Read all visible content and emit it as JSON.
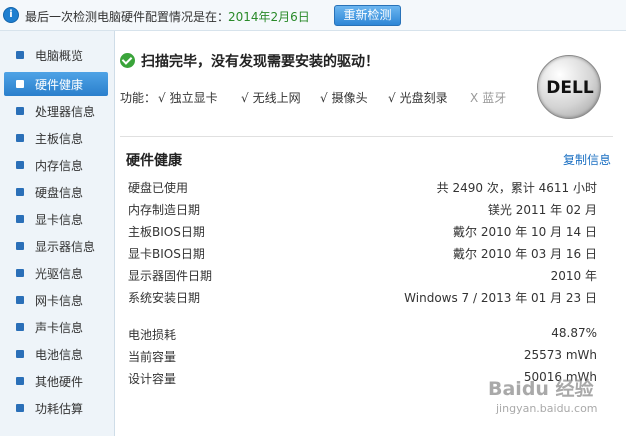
{
  "topbar": {
    "last_check_text": "最后一次检测电脑硬件配置情况是在：",
    "last_check_date": "2014年2月6日",
    "recheck_label": "重新检测"
  },
  "sidebar": {
    "items": [
      {
        "label": "电脑概览",
        "active": false
      },
      {
        "label": "硬件健康",
        "active": true
      },
      {
        "label": "处理器信息",
        "active": false
      },
      {
        "label": "主板信息",
        "active": false
      },
      {
        "label": "内存信息",
        "active": false
      },
      {
        "label": "硬盘信息",
        "active": false
      },
      {
        "label": "显卡信息",
        "active": false
      },
      {
        "label": "显示器信息",
        "active": false
      },
      {
        "label": "光驱信息",
        "active": false
      },
      {
        "label": "网卡信息",
        "active": false
      },
      {
        "label": "声卡信息",
        "active": false
      },
      {
        "label": "电池信息",
        "active": false
      },
      {
        "label": "其他硬件",
        "active": false
      },
      {
        "label": "功耗估算",
        "active": false
      }
    ]
  },
  "scan": {
    "title": "扫描完毕，没有发现需要安装的驱动！"
  },
  "features": {
    "label": "功能：",
    "items": [
      {
        "mark": "√",
        "name": "独立显卡",
        "available": true
      },
      {
        "mark": "√",
        "name": "无线上网",
        "available": true
      },
      {
        "mark": "√",
        "name": "摄像头",
        "available": true
      },
      {
        "mark": "√",
        "name": "光盘刻录",
        "available": true
      },
      {
        "mark": "X",
        "name": "蓝牙",
        "available": false
      }
    ]
  },
  "brand": {
    "logo_text": "DELL"
  },
  "health": {
    "title": "硬件健康",
    "copy_label": "复制信息",
    "rows": [
      {
        "label": "硬盘已使用",
        "value": "共 2490 次，累计 4611 小时"
      },
      {
        "label": "内存制造日期",
        "value": "镁光 2011 年 02 月"
      },
      {
        "label": "主板BIOS日期",
        "value": "戴尔 2010 年 10 月 14 日"
      },
      {
        "label": "显卡BIOS日期",
        "value": "戴尔 2010 年 03 月 16 日"
      },
      {
        "label": "显示器固件日期",
        "value": "2010 年"
      },
      {
        "label": "系统安装日期",
        "value": "Windows 7 / 2013 年 01 月 23 日"
      }
    ],
    "battery_rows": [
      {
        "label": "电池损耗",
        "value": "48.87%"
      },
      {
        "label": "当前容量",
        "value": "25573 mWh"
      },
      {
        "label": "设计容量",
        "value": "50016 mWh"
      }
    ]
  },
  "watermark": {
    "line1": "Baidu 经验",
    "line2": "jingyan.baidu.com"
  },
  "colors": {
    "accent": "#2a7fcc",
    "date_green": "#2a8a2a",
    "link_blue": "#1a6fc2"
  }
}
